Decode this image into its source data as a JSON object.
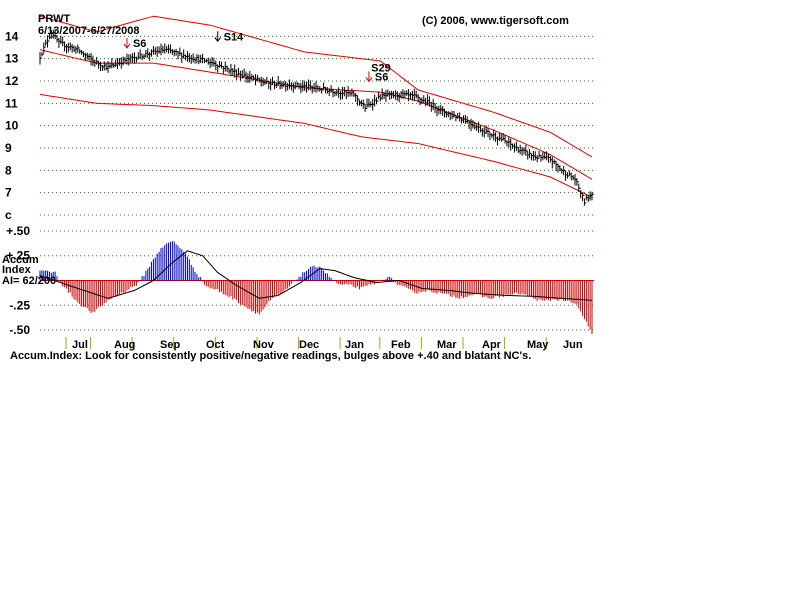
{
  "header": {
    "ticker": "PRWT",
    "date_range": "6/13/2007-6/27/2008",
    "copyright": "(C) 2006, www.tigersoft.com"
  },
  "indicator_label": {
    "line1": "Accum",
    "line2": "Index",
    "ai": "AI= 62/200"
  },
  "caption": "Accum.Index: Look for consistently positive/negative readings, bulges above +.40 and blatant NC's.",
  "colors": {
    "price_bar": "#000000",
    "band": "#dd0000",
    "positive": "#0000cc",
    "negative": "#cc0000",
    "grid": "#008800",
    "axis_tick": "#b8a000"
  },
  "chart_data": [
    {
      "type": "bar",
      "title": "PRWT 6/13/2007-6/27/2008",
      "yticks": [
        "14",
        "13",
        "12",
        "11",
        "10",
        "9",
        "8",
        "7",
        "c"
      ],
      "ylim": [
        6,
        15
      ],
      "months": [
        "Jul",
        "Aug",
        "Sep",
        "Oct",
        "Nov",
        "Dec",
        "Jan",
        "Feb",
        "Mar",
        "Apr",
        "May",
        "Jun"
      ],
      "grid": "dotted horizontal",
      "price_anchors": [
        [
          0,
          13.1
        ],
        [
          6,
          14.2
        ],
        [
          10,
          13.7
        ],
        [
          20,
          13.4
        ],
        [
          28,
          12.9
        ],
        [
          36,
          12.6
        ],
        [
          44,
          12.9
        ],
        [
          56,
          13.2
        ],
        [
          66,
          13.4
        ],
        [
          78,
          13.1
        ],
        [
          92,
          12.8
        ],
        [
          106,
          12.3
        ],
        [
          120,
          11.9
        ],
        [
          136,
          11.8
        ],
        [
          152,
          11.6
        ],
        [
          166,
          11.4
        ],
        [
          172,
          10.8
        ],
        [
          180,
          11.3
        ],
        [
          190,
          11.4
        ],
        [
          198,
          11.3
        ],
        [
          206,
          11.0
        ],
        [
          214,
          10.6
        ],
        [
          224,
          10.3
        ],
        [
          234,
          9.8
        ],
        [
          244,
          9.4
        ],
        [
          254,
          8.9
        ],
        [
          262,
          8.6
        ],
        [
          270,
          8.5
        ],
        [
          276,
          8.0
        ],
        [
          283,
          7.6
        ],
        [
          288,
          6.6
        ],
        [
          292,
          7.0
        ]
      ],
      "upper_band": [
        [
          0,
          14.9
        ],
        [
          30,
          14.2
        ],
        [
          60,
          14.9
        ],
        [
          90,
          14.5
        ],
        [
          140,
          13.3
        ],
        [
          180,
          12.9
        ],
        [
          200,
          11.6
        ],
        [
          240,
          10.6
        ],
        [
          270,
          9.7
        ],
        [
          292,
          8.6
        ]
      ],
      "middle_band": [
        [
          0,
          13.4
        ],
        [
          30,
          12.8
        ],
        [
          60,
          12.8
        ],
        [
          90,
          12.4
        ],
        [
          140,
          11.7
        ],
        [
          180,
          11.5
        ],
        [
          200,
          11.1
        ],
        [
          240,
          9.8
        ],
        [
          270,
          8.7
        ],
        [
          292,
          7.6
        ]
      ],
      "lower_band": [
        [
          0,
          11.4
        ],
        [
          30,
          11.0
        ],
        [
          60,
          10.9
        ],
        [
          90,
          10.7
        ],
        [
          140,
          10.1
        ],
        [
          170,
          9.5
        ],
        [
          200,
          9.2
        ],
        [
          240,
          8.4
        ],
        [
          270,
          7.7
        ],
        [
          292,
          6.8
        ]
      ],
      "signals": [
        {
          "label": "S6",
          "day": 46,
          "price": 13.3,
          "arrow": "red"
        },
        {
          "label": "S14",
          "day": 94,
          "price": 13.6,
          "arrow": "black"
        },
        {
          "label": "S29",
          "day": 172,
          "price": 12.2,
          "arrow": "none"
        },
        {
          "label": "S6",
          "day": 174,
          "price": 11.8,
          "arrow": "red"
        }
      ]
    },
    {
      "type": "bar",
      "title": "Accum Index",
      "yticks": [
        "+.50",
        "+.25",
        "-.25",
        "-.50"
      ],
      "ylim": [
        -0.55,
        0.55
      ],
      "accum_anchors": [
        [
          0,
          0.1
        ],
        [
          8,
          0.08
        ],
        [
          12,
          -0.05
        ],
        [
          20,
          -0.22
        ],
        [
          28,
          -0.33
        ],
        [
          36,
          -0.2
        ],
        [
          44,
          -0.12
        ],
        [
          52,
          -0.03
        ],
        [
          58,
          0.15
        ],
        [
          64,
          0.33
        ],
        [
          70,
          0.4
        ],
        [
          76,
          0.3
        ],
        [
          82,
          0.1
        ],
        [
          88,
          -0.06
        ],
        [
          94,
          -0.1
        ],
        [
          102,
          -0.18
        ],
        [
          110,
          -0.28
        ],
        [
          116,
          -0.34
        ],
        [
          122,
          -0.2
        ],
        [
          130,
          -0.1
        ],
        [
          136,
          0.02
        ],
        [
          142,
          0.12
        ],
        [
          148,
          0.15
        ],
        [
          152,
          0.06
        ],
        [
          158,
          -0.04
        ],
        [
          164,
          -0.05
        ],
        [
          170,
          -0.08
        ],
        [
          178,
          -0.02
        ],
        [
          184,
          0.04
        ],
        [
          190,
          -0.05
        ],
        [
          198,
          -0.12
        ],
        [
          206,
          -0.1
        ],
        [
          214,
          -0.14
        ],
        [
          222,
          -0.17
        ],
        [
          230,
          -0.14
        ],
        [
          238,
          -0.18
        ],
        [
          246,
          -0.15
        ],
        [
          254,
          -0.13
        ],
        [
          260,
          -0.17
        ],
        [
          266,
          -0.21
        ],
        [
          272,
          -0.19
        ],
        [
          278,
          -0.2
        ],
        [
          284,
          -0.25
        ],
        [
          289,
          -0.42
        ],
        [
          292,
          -0.55
        ]
      ],
      "signal_line": [
        [
          0,
          0.05
        ],
        [
          20,
          -0.08
        ],
        [
          36,
          -0.18
        ],
        [
          50,
          -0.1
        ],
        [
          60,
          0.0
        ],
        [
          70,
          0.18
        ],
        [
          78,
          0.3
        ],
        [
          86,
          0.25
        ],
        [
          94,
          0.08
        ],
        [
          104,
          -0.05
        ],
        [
          116,
          -0.18
        ],
        [
          126,
          -0.15
        ],
        [
          138,
          -0.02
        ],
        [
          148,
          0.12
        ],
        [
          156,
          0.1
        ],
        [
          166,
          0.03
        ],
        [
          178,
          -0.02
        ],
        [
          190,
          0.0
        ],
        [
          202,
          -0.08
        ],
        [
          216,
          -0.1
        ],
        [
          230,
          -0.13
        ],
        [
          246,
          -0.15
        ],
        [
          262,
          -0.16
        ],
        [
          276,
          -0.18
        ],
        [
          292,
          -0.2
        ]
      ]
    }
  ]
}
